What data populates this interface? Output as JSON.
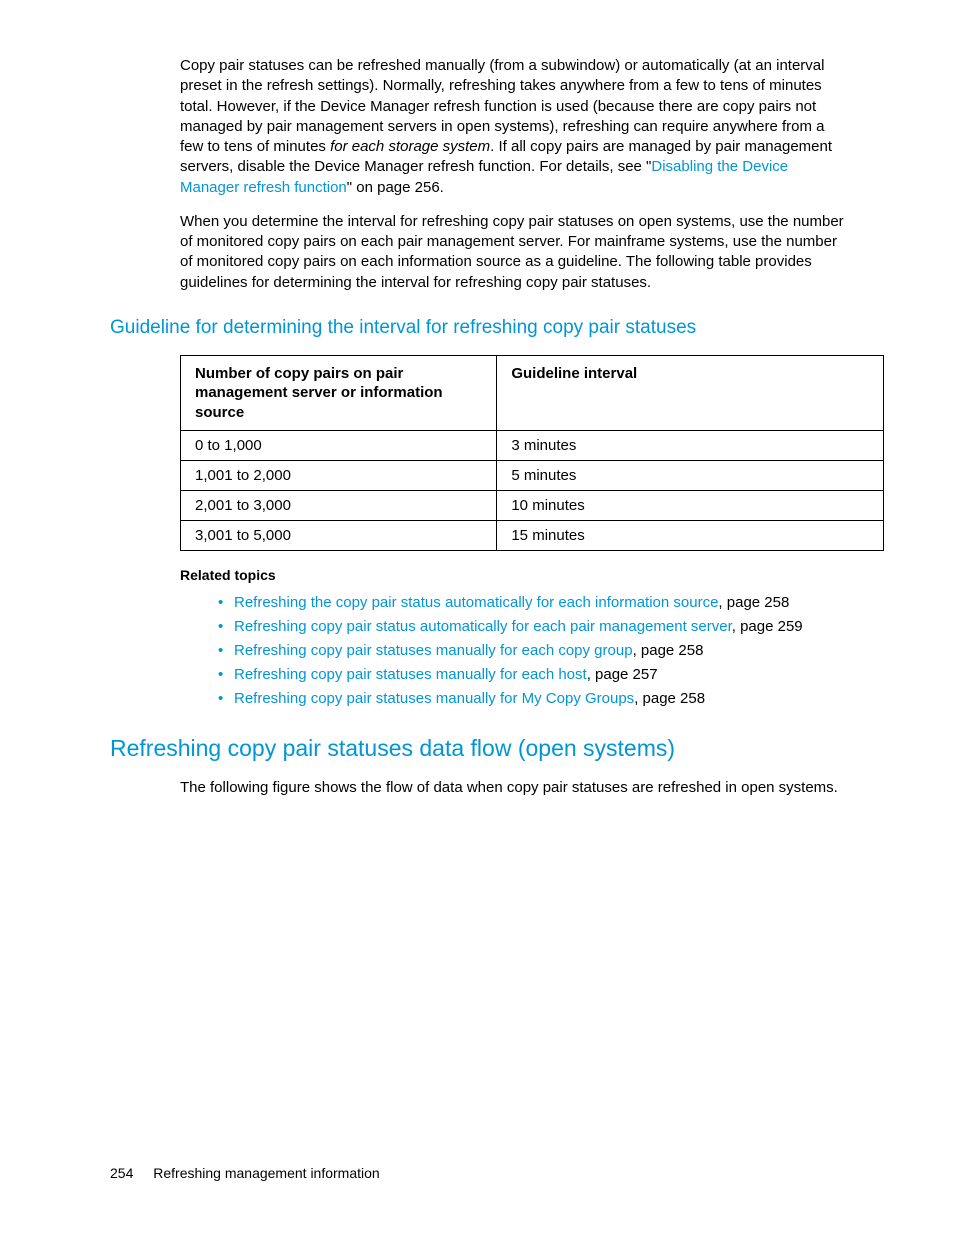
{
  "paragraphs": {
    "p1_a": "Copy pair statuses can be refreshed manually (from a subwindow) or automatically (at an interval preset in the refresh settings). Normally, refreshing takes anywhere from a few to tens of minutes total. However, if the Device Manager refresh function is used (because there are copy pairs not managed by pair management servers in open systems), refreshing can require anywhere from a few to tens of minutes ",
    "p1_italic": "for each storage system",
    "p1_b": ". If all copy pairs are managed by pair management servers, disable the Device Manager refresh function. For details, see \"",
    "p1_link": "Disabling the Device Manager refresh function",
    "p1_c": "\" on page 256.",
    "p2": "When you determine the interval for refreshing copy pair statuses on open systems, use the number of monitored copy pairs on each pair management server. For mainframe systems, use the number of monitored copy pairs on each information source as a guideline. The following table provides guidelines for determining the interval for refreshing copy pair statuses.",
    "p3": "The following figure shows the flow of data when copy pair statuses are refreshed in open systems."
  },
  "headings": {
    "h1": "Guideline for determining the interval for refreshing copy pair statuses",
    "h2": "Refreshing copy pair statuses data flow (open systems)"
  },
  "table": {
    "headers": {
      "c1": "Number of copy pairs on pair management server or information source",
      "c2": "Guideline interval"
    },
    "rows": [
      {
        "c1": "0 to 1,000",
        "c2": "3 minutes"
      },
      {
        "c1": "1,001 to 2,000",
        "c2": "5 minutes"
      },
      {
        "c1": "2,001 to 3,000",
        "c2": "10 minutes"
      },
      {
        "c1": "3,001 to 5,000",
        "c2": "15 minutes"
      }
    ]
  },
  "related": {
    "heading": "Related topics",
    "items": [
      {
        "link": "Refreshing the copy pair status automatically for each information source",
        "tail": ", page 258"
      },
      {
        "link": "Refreshing copy pair status automatically for each pair management server",
        "tail": ", page 259"
      },
      {
        "link": "Refreshing copy pair statuses manually for each copy group",
        "tail": ", page 258"
      },
      {
        "link": "Refreshing copy pair statuses manually for each host",
        "tail": ", page 257"
      },
      {
        "link": "Refreshing copy pair statuses manually for My Copy Groups",
        "tail": ", page 258"
      }
    ]
  },
  "footer": {
    "page_number": "254",
    "section": "Refreshing management information"
  }
}
